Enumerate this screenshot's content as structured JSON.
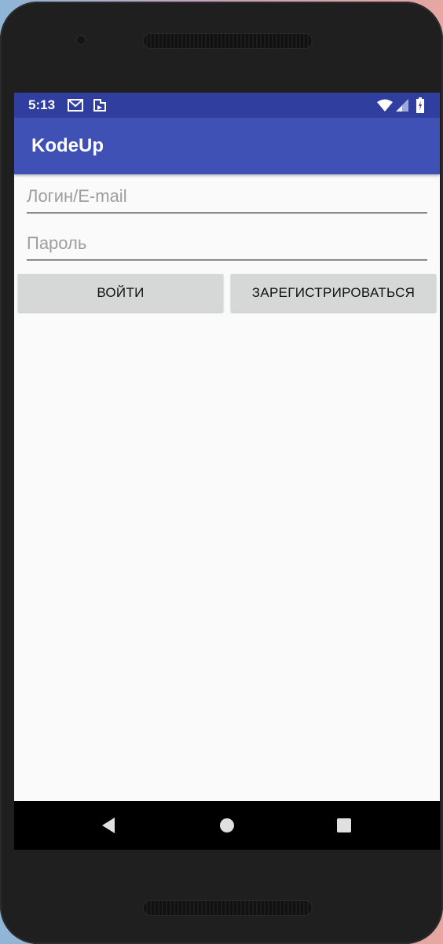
{
  "status_bar": {
    "time": "5:13",
    "icons": [
      "gmail-icon",
      "play-store-icon",
      "wifi-icon",
      "cell-signal-icon",
      "battery-icon"
    ],
    "background": "#303f9f"
  },
  "app_bar": {
    "title": "KodeUp",
    "background": "#3f51b5"
  },
  "form": {
    "login_placeholder": "Логин/E-mail",
    "login_value": "",
    "password_placeholder": "Пароль",
    "password_value": ""
  },
  "buttons": {
    "login_label": "ВОЙТИ",
    "register_label": "ЗАРЕГИСТРИРОВАТЬСЯ"
  },
  "nav_bar": {
    "icons": [
      "back-icon",
      "home-icon",
      "recents-icon"
    ]
  }
}
